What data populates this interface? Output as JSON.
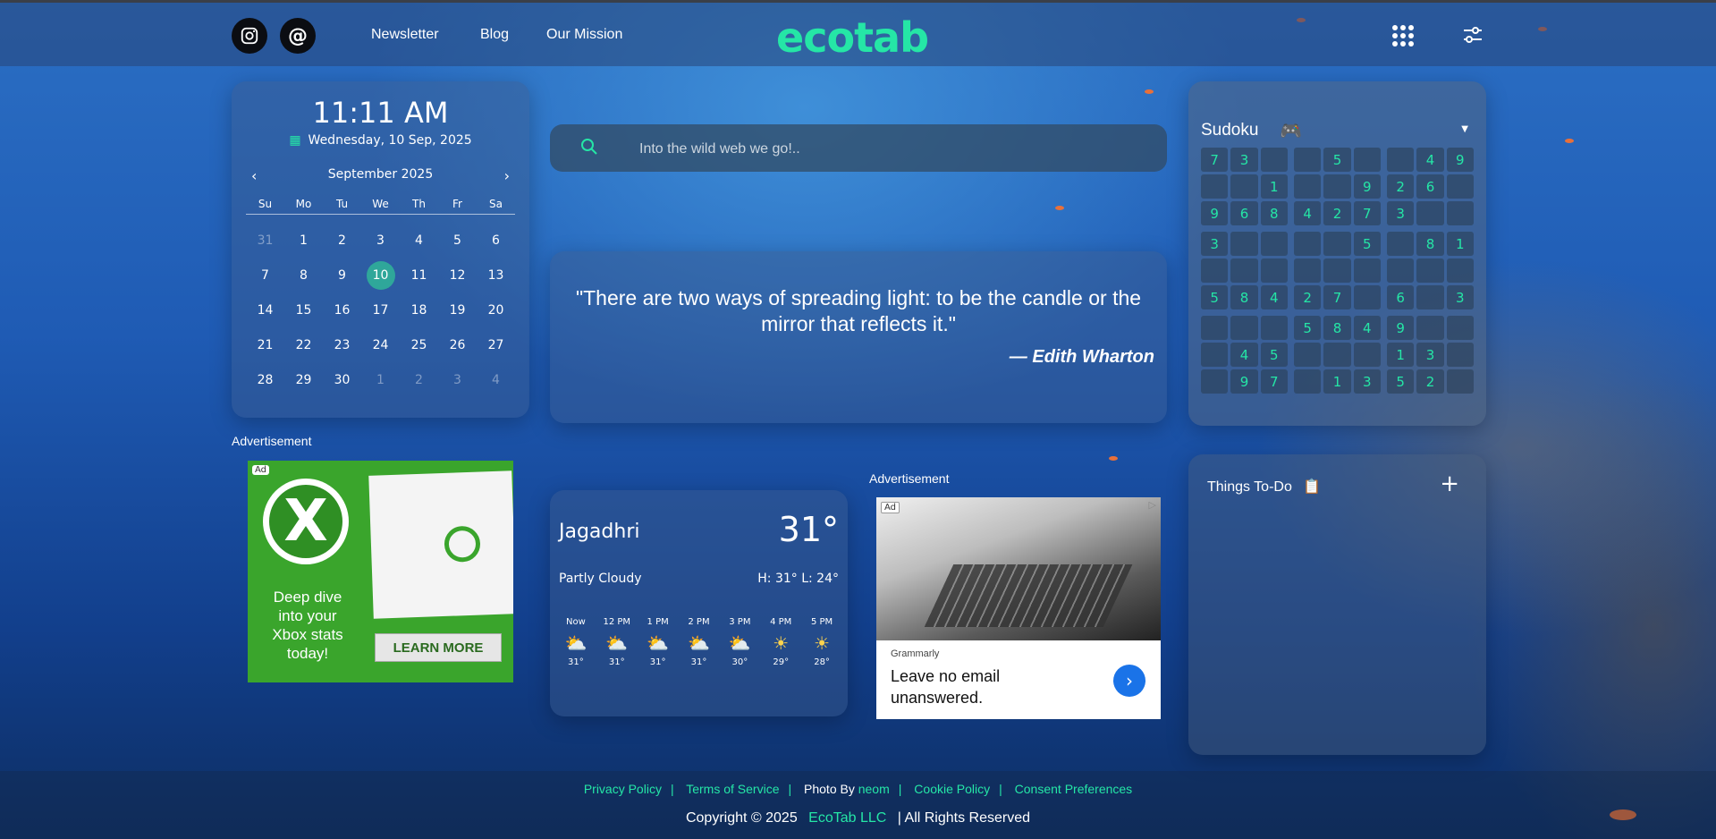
{
  "nav": {
    "links": [
      "Newsletter",
      "Blog",
      "Our Mission"
    ],
    "logo": "ecotab"
  },
  "clock": {
    "time": "11:11 AM",
    "date": "Wednesday, 10 Sep, 2025"
  },
  "calendar": {
    "month": "September 2025",
    "weekdays": [
      "Su",
      "Mo",
      "Tu",
      "We",
      "Th",
      "Fr",
      "Sa"
    ],
    "days": [
      {
        "d": "31",
        "dim": true
      },
      {
        "d": "1"
      },
      {
        "d": "2"
      },
      {
        "d": "3"
      },
      {
        "d": "4"
      },
      {
        "d": "5"
      },
      {
        "d": "6"
      },
      {
        "d": "7"
      },
      {
        "d": "8"
      },
      {
        "d": "9"
      },
      {
        "d": "10",
        "today": true
      },
      {
        "d": "11"
      },
      {
        "d": "12"
      },
      {
        "d": "13"
      },
      {
        "d": "14"
      },
      {
        "d": "15"
      },
      {
        "d": "16"
      },
      {
        "d": "17"
      },
      {
        "d": "18"
      },
      {
        "d": "19"
      },
      {
        "d": "20"
      },
      {
        "d": "21"
      },
      {
        "d": "22"
      },
      {
        "d": "23"
      },
      {
        "d": "24"
      },
      {
        "d": "25"
      },
      {
        "d": "26"
      },
      {
        "d": "27"
      },
      {
        "d": "28"
      },
      {
        "d": "29"
      },
      {
        "d": "30"
      },
      {
        "d": "1",
        "dim": true
      },
      {
        "d": "2",
        "dim": true
      },
      {
        "d": "3",
        "dim": true
      },
      {
        "d": "4",
        "dim": true
      }
    ]
  },
  "search": {
    "placeholder": "Into the wild web we go!.."
  },
  "quote": {
    "text": "\"There are two ways of spreading light: to be the candle or the mirror that reflects it.\"",
    "author": "— Edith Wharton"
  },
  "weather": {
    "city": "Jagadhri",
    "temp": "31°",
    "condition": "Partly Cloudy",
    "high_low": "H: 31°  L: 24°",
    "hours": [
      {
        "t": "Now",
        "icon": "partly-cloudy",
        "v": "31°"
      },
      {
        "t": "12 PM",
        "icon": "partly-cloudy",
        "v": "31°"
      },
      {
        "t": "1 PM",
        "icon": "partly-cloudy",
        "v": "31°"
      },
      {
        "t": "2 PM",
        "icon": "partly-cloudy",
        "v": "31°"
      },
      {
        "t": "3 PM",
        "icon": "partly-cloudy",
        "v": "30°"
      },
      {
        "t": "4 PM",
        "icon": "sun",
        "v": "29°"
      },
      {
        "t": "5 PM",
        "icon": "sun",
        "v": "28°"
      }
    ]
  },
  "ads": {
    "label": "Advertisement",
    "tag": "Ad",
    "xbox": {
      "text": "Deep dive into your Xbox stats today!",
      "cta": "LEARN MORE"
    },
    "grammarly": {
      "brand": "Grammarly",
      "headline": "Leave no email unanswered."
    }
  },
  "sudoku": {
    "title": "Sudoku",
    "rows": [
      [
        "7",
        "3",
        "",
        "",
        "5",
        "",
        "",
        "4",
        "9"
      ],
      [
        "",
        "",
        "1",
        "",
        "",
        "9",
        "2",
        "6",
        ""
      ],
      [
        "9",
        "6",
        "8",
        "4",
        "2",
        "7",
        "3",
        "",
        ""
      ],
      [
        "3",
        "",
        "",
        "",
        "",
        "5",
        "",
        "8",
        "1"
      ],
      [
        "",
        "",
        "",
        "",
        "",
        "",
        "",
        "",
        ""
      ],
      [
        "5",
        "8",
        "4",
        "2",
        "7",
        "",
        "6",
        "",
        "3"
      ],
      [
        "",
        "",
        "",
        "5",
        "8",
        "4",
        "9",
        "",
        ""
      ],
      [
        "",
        "4",
        "5",
        "",
        "",
        "",
        "1",
        "3",
        ""
      ],
      [
        "",
        "9",
        "7",
        "",
        "1",
        "3",
        "5",
        "2",
        ""
      ]
    ]
  },
  "todo": {
    "title": "Things To-Do"
  },
  "footer": {
    "links": [
      "Privacy Policy",
      "Terms of Service",
      "Photo By",
      "neom",
      "Cookie Policy",
      "Consent Preferences"
    ],
    "copyright": "Copyright © 2025",
    "brand": "EcoTab LLC",
    "rights": "| All Rights Reserved"
  },
  "colors": {
    "accent": "#25e6a6"
  }
}
